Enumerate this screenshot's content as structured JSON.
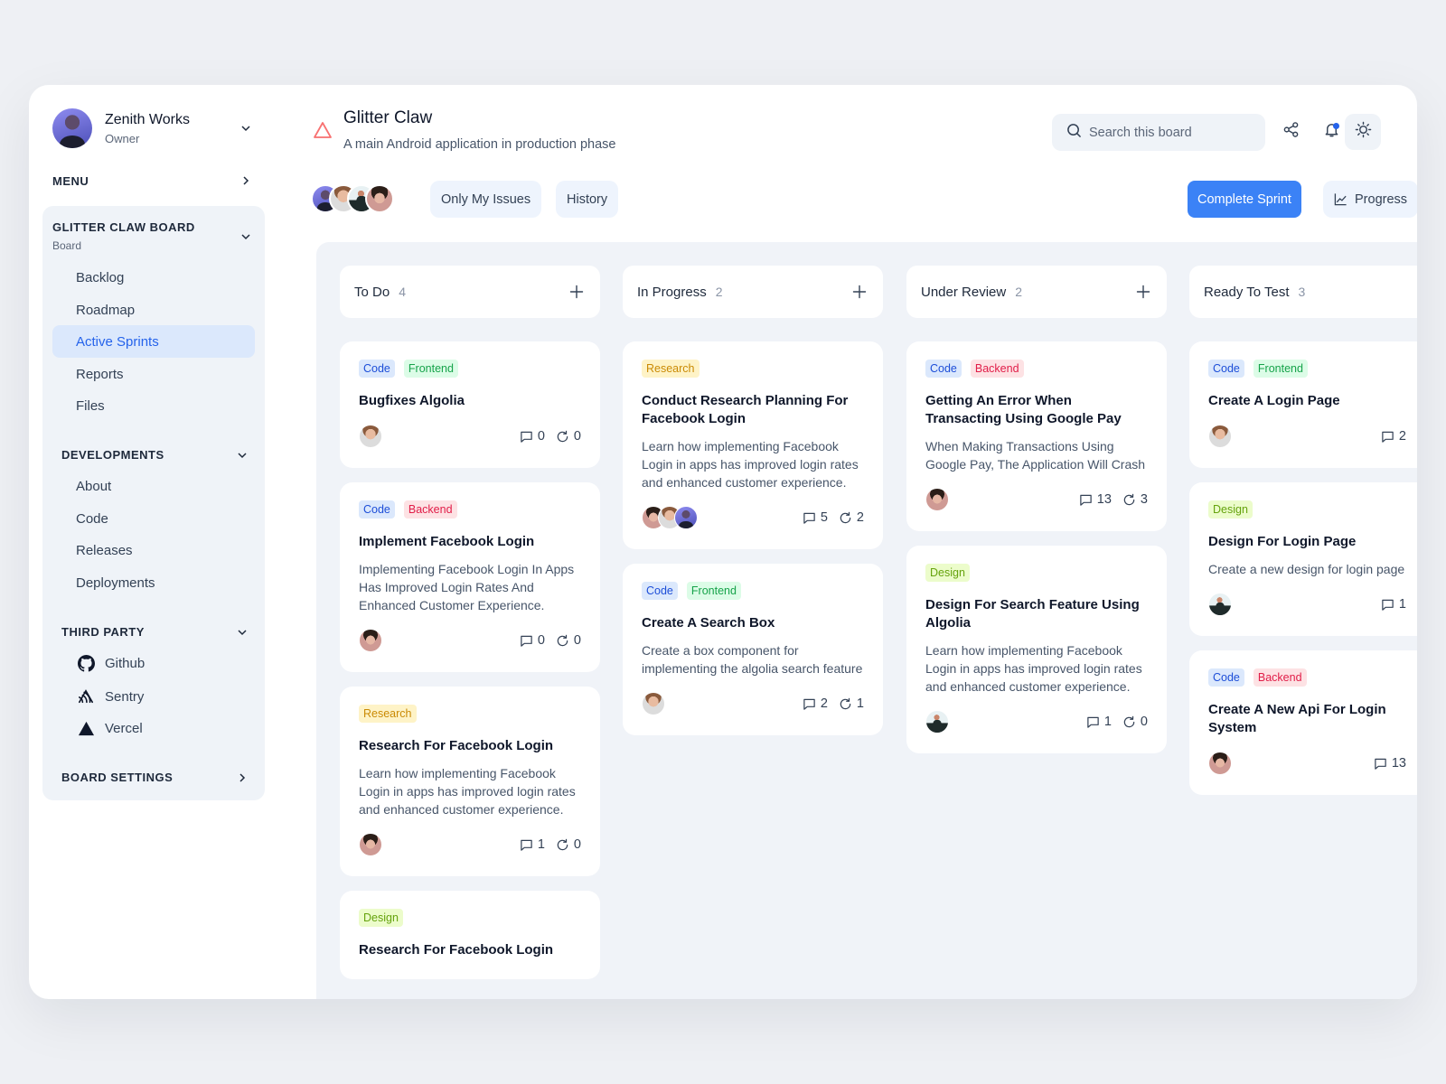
{
  "sidebar": {
    "profile": {
      "name": "Zenith Works",
      "role": "Owner"
    },
    "menu_label": "MENU",
    "board": {
      "title": "GLITTER CLAW BOARD",
      "subtitle": "Board",
      "items": [
        {
          "label": "Backlog",
          "active": false
        },
        {
          "label": "Roadmap",
          "active": false
        },
        {
          "label": "Active Sprints",
          "active": true
        },
        {
          "label": "Reports",
          "active": false
        },
        {
          "label": "Files",
          "active": false
        }
      ]
    },
    "developments": {
      "title": "DEVELOPMENTS",
      "items": [
        {
          "label": "About"
        },
        {
          "label": "Code"
        },
        {
          "label": "Releases"
        },
        {
          "label": "Deployments"
        }
      ]
    },
    "third_party": {
      "title": "THIRD PARTY",
      "items": [
        {
          "label": "Github",
          "icon": "github-icon"
        },
        {
          "label": "Sentry",
          "icon": "sentry-icon"
        },
        {
          "label": "Vercel",
          "icon": "vercel-icon"
        }
      ]
    },
    "board_settings": "BOARD SETTINGS"
  },
  "header": {
    "project_icon": "warning-triangle-icon",
    "title": "Glitter Claw",
    "description": "A main Android application in production phase",
    "search_placeholder": "Search this board",
    "only_my_issues": "Only My Issues",
    "history": "History",
    "complete_sprint": "Complete Sprint",
    "progress": "Progress",
    "accent_color": "#3b82f6",
    "warning_color": "#f87171"
  },
  "columns": [
    {
      "title": "To Do",
      "count": "4",
      "cards": [
        {
          "tags": [
            {
              "label": "Code",
              "kind": "code"
            },
            {
              "label": "Frontend",
              "kind": "frontend"
            }
          ],
          "title": "Bugfixes Algolia",
          "description": "",
          "assignees": [
            "a"
          ],
          "comments": "0",
          "reopens": "0"
        },
        {
          "tags": [
            {
              "label": "Code",
              "kind": "code"
            },
            {
              "label": "Backend",
              "kind": "backend"
            }
          ],
          "title": "Implement Facebook Login",
          "description": "Implementing Facebook Login In Apps Has Improved Login Rates And Enhanced Customer Experience.",
          "assignees": [
            "b"
          ],
          "comments": "0",
          "reopens": "0"
        },
        {
          "tags": [
            {
              "label": "Research",
              "kind": "research"
            }
          ],
          "title": "Research For Facebook Login",
          "description": "Learn how implementing Facebook Login in apps has improved login rates and enhanced customer experience.",
          "assignees": [
            "b"
          ],
          "comments": "1",
          "reopens": "0"
        },
        {
          "tags": [
            {
              "label": "Design",
              "kind": "design"
            }
          ],
          "title": "Research For Facebook Login",
          "description": "",
          "assignees": [],
          "comments": "",
          "reopens": ""
        }
      ]
    },
    {
      "title": "In Progress",
      "count": "2",
      "cards": [
        {
          "tags": [
            {
              "label": "Research",
              "kind": "research"
            }
          ],
          "title": "Conduct Research Planning For Facebook Login",
          "description": "Learn how implementing Facebook Login in apps has improved login rates and enhanced customer experience.",
          "assignees": [
            "b",
            "a",
            "d"
          ],
          "comments": "5",
          "reopens": "2"
        },
        {
          "tags": [
            {
              "label": "Code",
              "kind": "code"
            },
            {
              "label": "Frontend",
              "kind": "frontend"
            }
          ],
          "title": "Create A Search Box",
          "description": "Create a box component for implementing the algolia search feature",
          "assignees": [
            "a"
          ],
          "comments": "2",
          "reopens": "1"
        }
      ]
    },
    {
      "title": "Under Review",
      "count": "2",
      "cards": [
        {
          "tags": [
            {
              "label": "Code",
              "kind": "code"
            },
            {
              "label": "Backend",
              "kind": "backend"
            }
          ],
          "title": "Getting An Error When Transacting Using Google Pay",
          "description": "When Making Transactions Using Google Pay, The Application Will Crash",
          "assignees": [
            "b"
          ],
          "comments": "13",
          "reopens": "3"
        },
        {
          "tags": [
            {
              "label": "Design",
              "kind": "design"
            }
          ],
          "title": "Design For Search Feature Using Algolia",
          "description": "Learn how implementing Facebook Login in apps has improved login rates and enhanced customer experience.",
          "assignees": [
            "c"
          ],
          "comments": "1",
          "reopens": "0"
        }
      ]
    },
    {
      "title": "Ready To Test",
      "count": "3",
      "cards": [
        {
          "tags": [
            {
              "label": "Code",
              "kind": "code"
            },
            {
              "label": "Frontend",
              "kind": "frontend"
            }
          ],
          "title": "Create A Login Page",
          "description": "",
          "assignees": [
            "a"
          ],
          "comments": "2",
          "reopens": ""
        },
        {
          "tags": [
            {
              "label": "Design",
              "kind": "design"
            }
          ],
          "title": "Design For Login Page",
          "description": "Create a new design for login page",
          "assignees": [
            "c"
          ],
          "comments": "1",
          "reopens": ""
        },
        {
          "tags": [
            {
              "label": "Code",
              "kind": "code"
            },
            {
              "label": "Backend",
              "kind": "backend"
            }
          ],
          "title": "Create A New Api For Login System",
          "description": "",
          "assignees": [
            "b"
          ],
          "comments": "13",
          "reopens": ""
        }
      ]
    }
  ]
}
